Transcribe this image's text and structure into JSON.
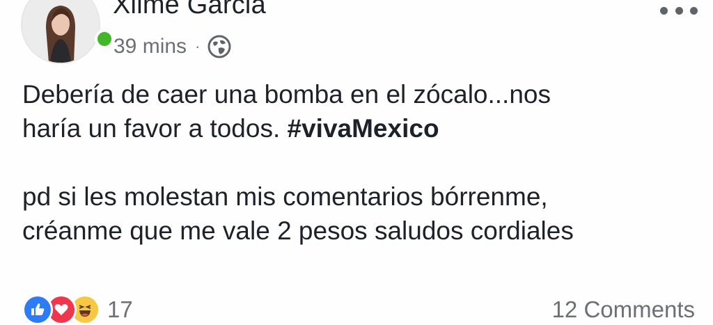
{
  "author": {
    "name": "Xiime Garcia",
    "online": true
  },
  "meta": {
    "time": "39 mins",
    "separator": "·",
    "privacy_icon": "globe-icon"
  },
  "post": {
    "lines_paragraph1": [
      "Debería de caer una bomba en el zócalo...nos",
      "haría un favor a todos. "
    ],
    "hashtag": "#vivaMexico",
    "lines_paragraph2": [
      "pd si les molestan mis comentarios bórrenme,",
      "créanme que me vale 2 pesos  saludos cordiales"
    ]
  },
  "reactions": {
    "icons": [
      "like-icon",
      "love-icon",
      "haha-icon"
    ],
    "count": "17"
  },
  "comments": {
    "label": "12 Comments"
  },
  "colors": {
    "online": "#42b72a",
    "like": "#2d7cf6",
    "love": "#f0364f",
    "haha": "#f7c844",
    "secondary_text": "#6b6f76",
    "primary_text": "#1d2129"
  }
}
